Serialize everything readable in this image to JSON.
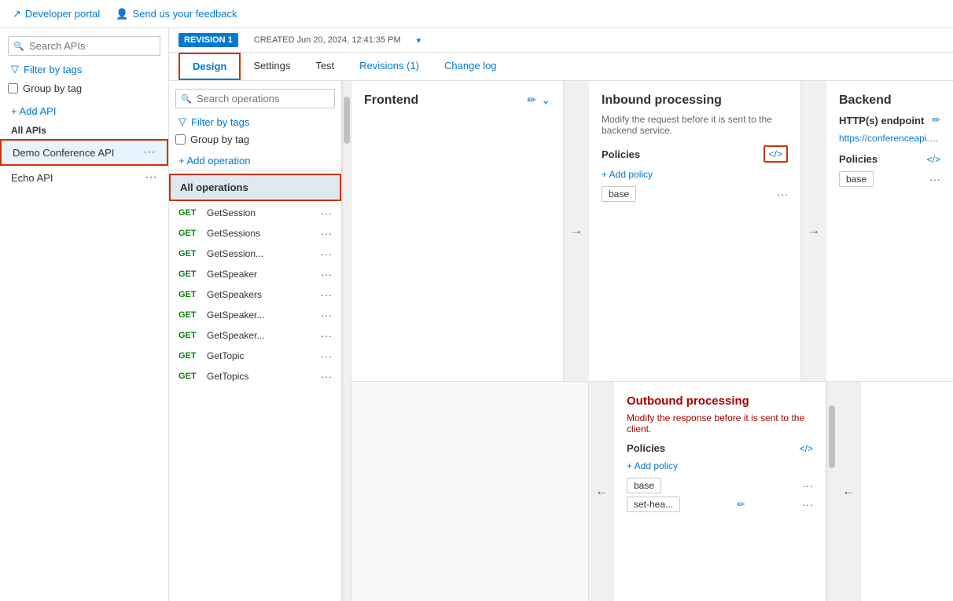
{
  "topbar": {
    "dev_portal_label": "Developer portal",
    "feedback_label": "Send us your feedback"
  },
  "revision_header": {
    "badge": "REVISION 1",
    "created_label": "CREATED Jun 20, 2024, 12:41:35 PM"
  },
  "tabs": [
    {
      "id": "design",
      "label": "Design",
      "active": true
    },
    {
      "id": "settings",
      "label": "Settings",
      "active": false
    },
    {
      "id": "test",
      "label": "Test",
      "active": false
    },
    {
      "id": "revisions",
      "label": "Revisions (1)",
      "active": false
    },
    {
      "id": "changelog",
      "label": "Change log",
      "active": false
    }
  ],
  "sidebar": {
    "search_placeholder": "Search APIs",
    "filter_label": "Filter by tags",
    "group_label": "Group by tag",
    "add_api_label": "+ Add API",
    "section_label": "All APIs",
    "apis": [
      {
        "name": "Demo Conference API",
        "selected": true
      },
      {
        "name": "Echo API",
        "selected": false
      }
    ]
  },
  "operations": {
    "search_placeholder": "Search operations",
    "filter_label": "Filter by tags",
    "group_label": "Group by tag",
    "add_op_label": "+ Add operation",
    "all_ops_label": "All operations",
    "items": [
      {
        "method": "GET",
        "name": "GetSession"
      },
      {
        "method": "GET",
        "name": "GetSessions"
      },
      {
        "method": "GET",
        "name": "GetSession..."
      },
      {
        "method": "GET",
        "name": "GetSpeaker"
      },
      {
        "method": "GET",
        "name": "GetSpeakers"
      },
      {
        "method": "GET",
        "name": "GetSpeaker..."
      },
      {
        "method": "GET",
        "name": "GetSpeaker..."
      },
      {
        "method": "GET",
        "name": "GetTopic"
      },
      {
        "method": "GET",
        "name": "GetTopics"
      }
    ]
  },
  "frontend": {
    "title": "Frontend"
  },
  "inbound": {
    "title": "Inbound processing",
    "description": "Modify the request before it is sent to the backend service.",
    "policies_label": "Policies",
    "add_policy_label": "+ Add policy",
    "base_badge": "base"
  },
  "backend": {
    "title": "Backend",
    "endpoint_label": "HTTP(s) endpoint",
    "endpoint_url": "https://conferenceapi.azurewebsit...",
    "policies_label": "Policies",
    "base_badge": "base"
  },
  "outbound": {
    "title": "Outbound processing",
    "description": "Modify the response before it is sent to the client.",
    "policies_label": "Policies",
    "add_policy_label": "+ Add policy",
    "base_badge": "base",
    "set_hea_badge": "set-hea..."
  },
  "icons": {
    "search": "🔍",
    "filter": "▼",
    "pencil": "✏",
    "chevron_down": "⌄",
    "arrow_right": "→",
    "arrow_left": "←",
    "code": "</>",
    "dots": "···",
    "plus": "+",
    "external": "↗"
  }
}
